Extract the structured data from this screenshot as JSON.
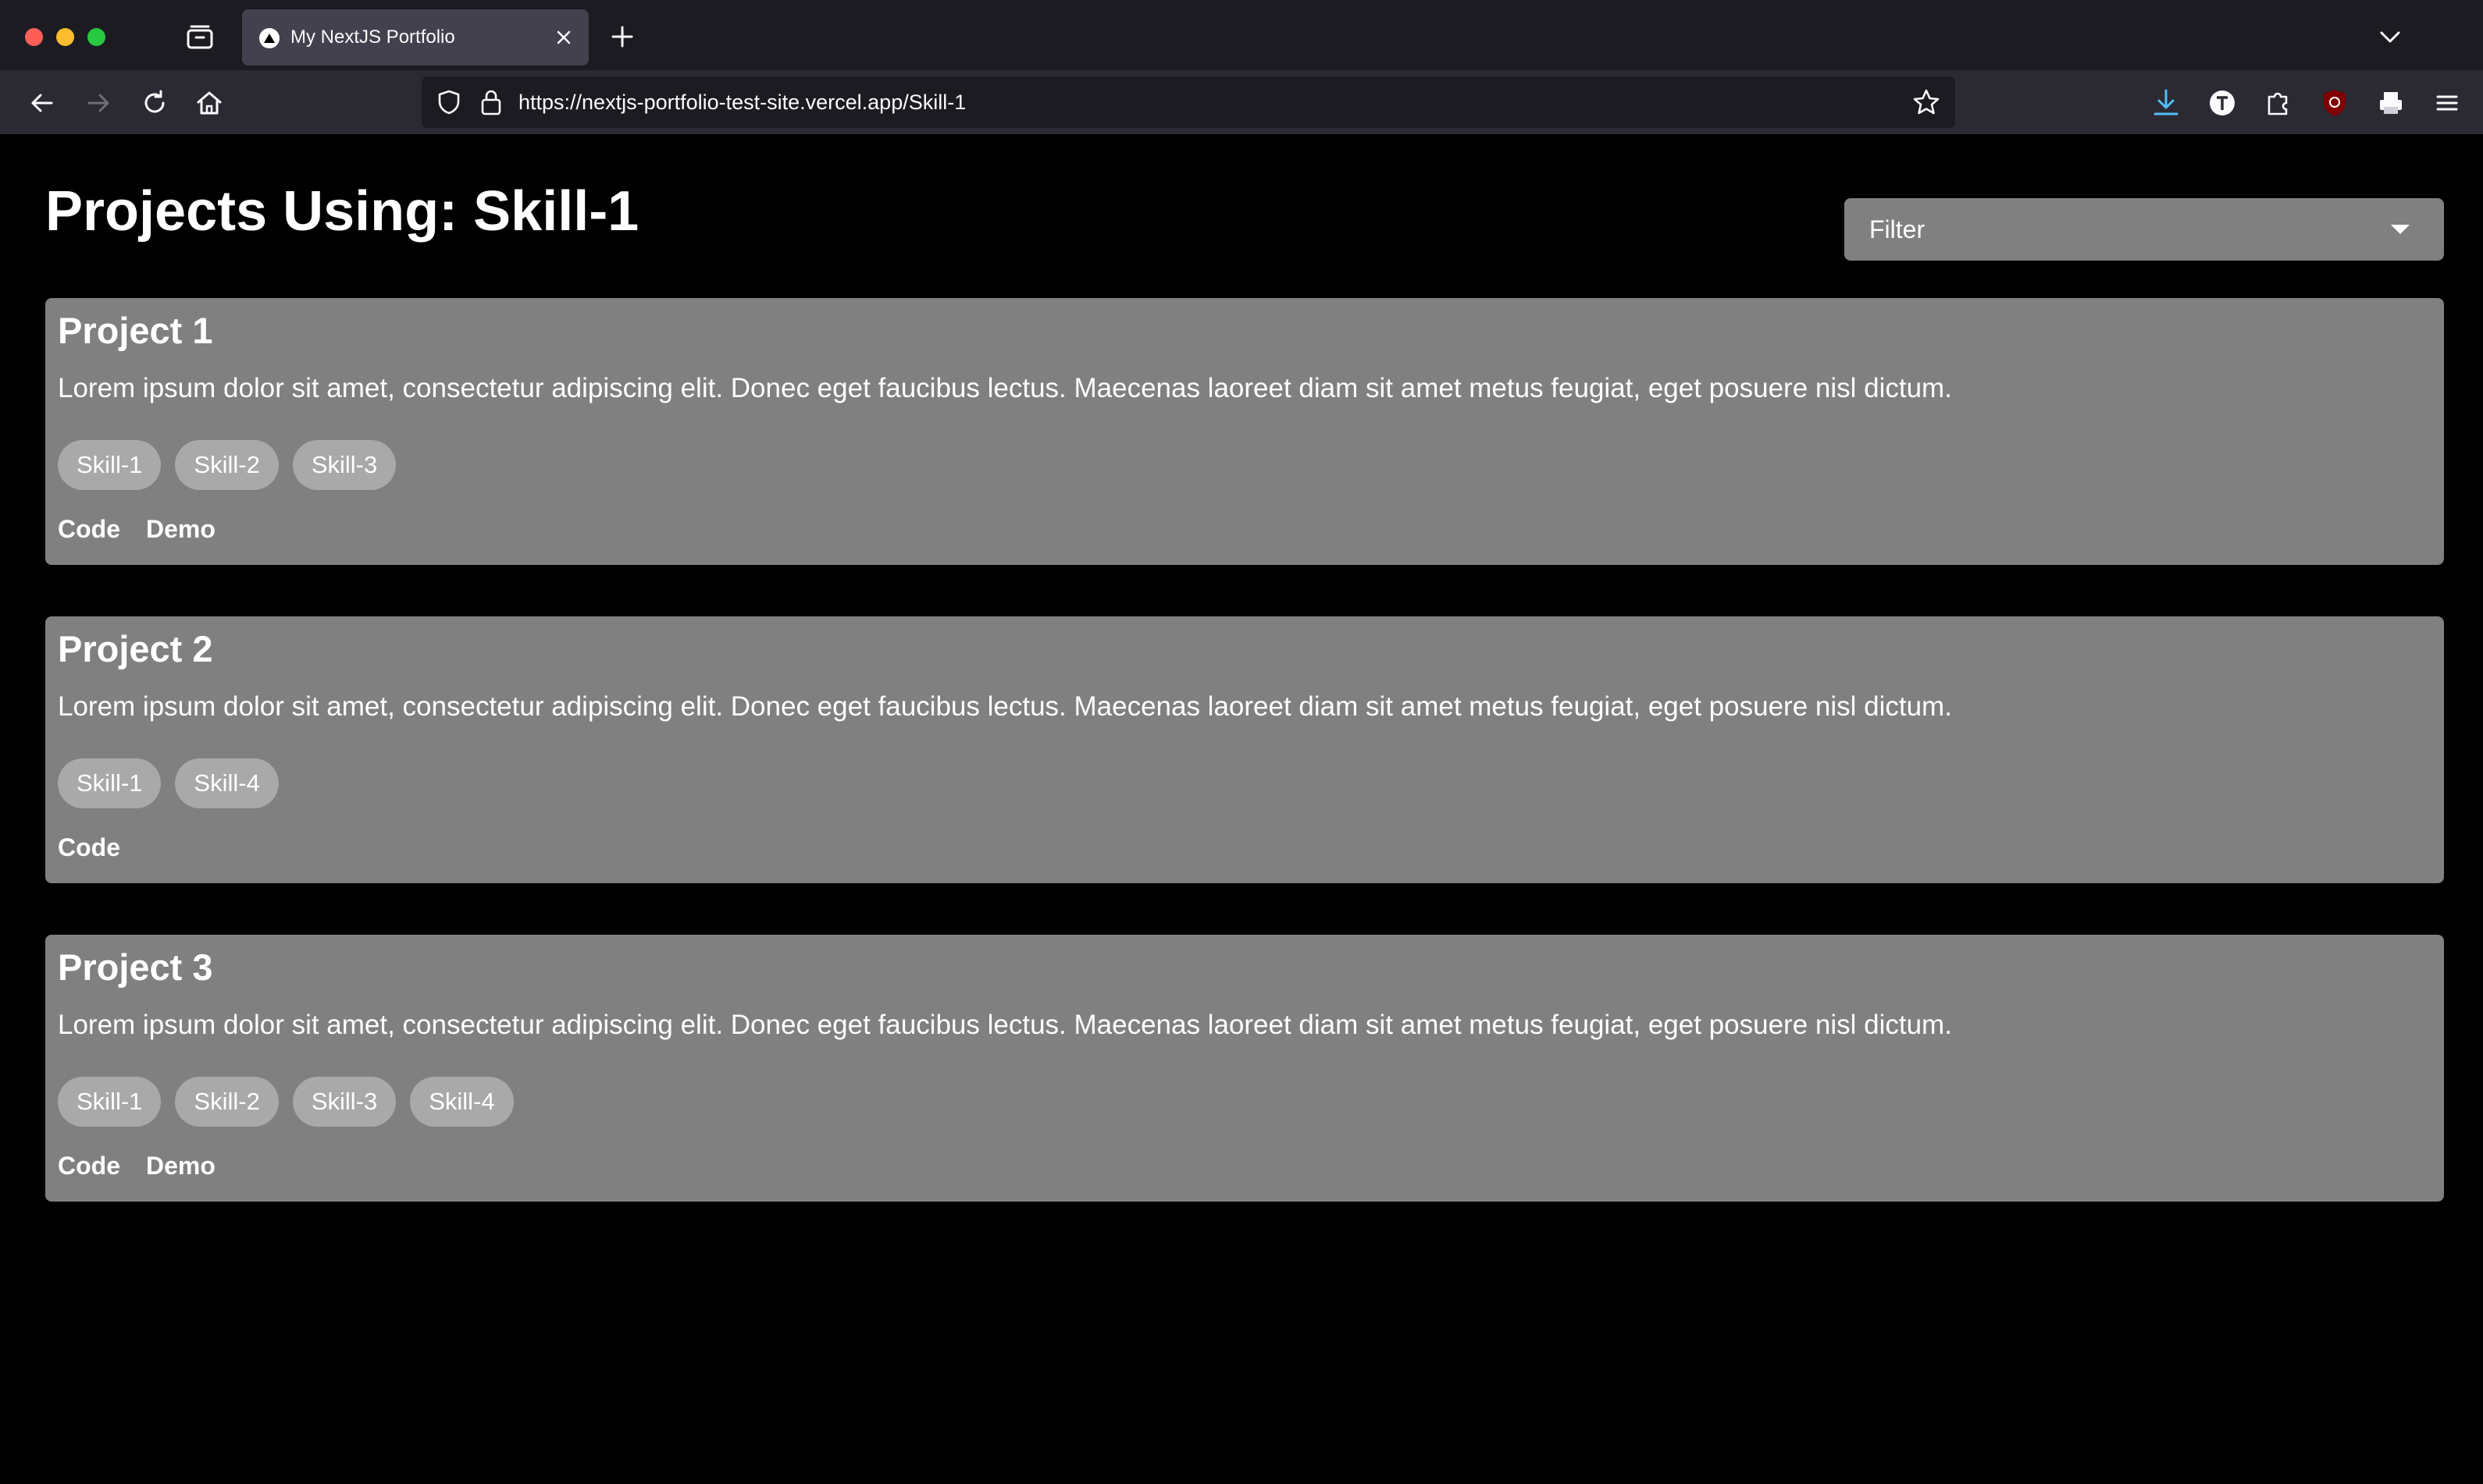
{
  "browser": {
    "tab_title": "My NextJS Portfolio",
    "url": "https://nextjs-portfolio-test-site.vercel.app/Skill-1"
  },
  "page": {
    "title": "Projects Using: Skill-1",
    "filter": {
      "selected": "Filter"
    }
  },
  "projects": [
    {
      "title": "Project 1",
      "description": "Lorem ipsum dolor sit amet, consectetur adipiscing elit. Donec eget faucibus lectus. Maecenas laoreet diam sit amet metus feugiat, eget posuere nisl dictum.",
      "skills": [
        "Skill-1",
        "Skill-2",
        "Skill-3"
      ],
      "links": [
        "Code",
        "Demo"
      ]
    },
    {
      "title": "Project 2",
      "description": "Lorem ipsum dolor sit amet, consectetur adipiscing elit. Donec eget faucibus lectus. Maecenas laoreet diam sit amet metus feugiat, eget posuere nisl dictum.",
      "skills": [
        "Skill-1",
        "Skill-4"
      ],
      "links": [
        "Code"
      ]
    },
    {
      "title": "Project 3",
      "description": "Lorem ipsum dolor sit amet, consectetur adipiscing elit. Donec eget faucibus lectus. Maecenas laoreet diam sit amet metus feugiat, eget posuere nisl dictum.",
      "skills": [
        "Skill-1",
        "Skill-2",
        "Skill-3",
        "Skill-4"
      ],
      "links": [
        "Code",
        "Demo"
      ]
    }
  ],
  "colors": {
    "page_background": "#000000",
    "card_background": "#808080",
    "chip_background": "#a9a9a9",
    "text": "#ffffff"
  }
}
